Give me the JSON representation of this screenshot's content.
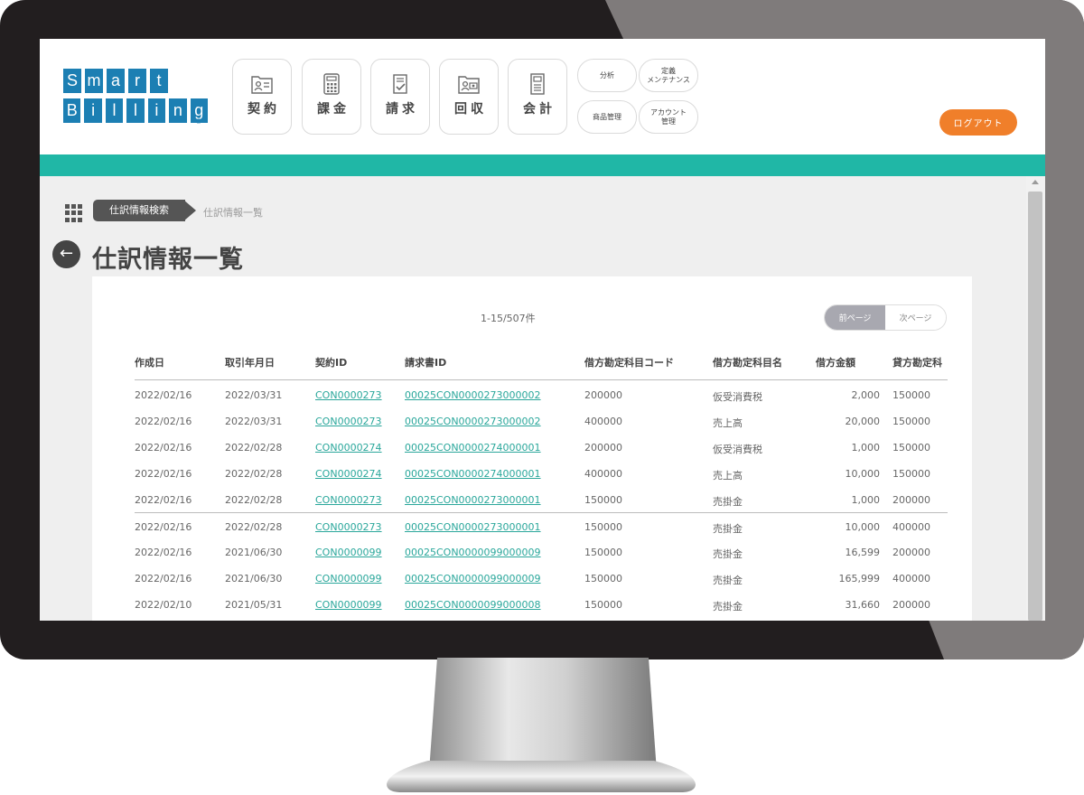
{
  "logo": {
    "line1": [
      "S",
      "m",
      "a",
      "r",
      "t"
    ],
    "line2": [
      "B",
      "i",
      "l",
      "l",
      "i",
      "n",
      "g"
    ],
    "reg": "®"
  },
  "nav": {
    "main": [
      {
        "label": "契約",
        "icon": "contract-icon"
      },
      {
        "label": "課金",
        "icon": "calculator-icon"
      },
      {
        "label": "請求",
        "icon": "invoice-icon"
      },
      {
        "label": "回収",
        "icon": "collection-icon"
      },
      {
        "label": "会計",
        "icon": "accounting-icon"
      }
    ],
    "sub": [
      {
        "label": "分析"
      },
      {
        "label": "定義\nメンテナンス"
      },
      {
        "label": "商品管理"
      },
      {
        "label": "アカウント\n管理"
      }
    ],
    "logout": "ログアウト"
  },
  "breadcrumb": {
    "parent": "仕訳情報検索",
    "current": "仕訳情報一覧"
  },
  "page": {
    "title": "仕訳情報一覧",
    "back_icon": "←"
  },
  "pagination": {
    "count": "1-15/507件",
    "prev": "前ページ",
    "next": "次ページ"
  },
  "table": {
    "headers": [
      "作成日",
      "取引年月日",
      "契約ID",
      "請求書ID",
      "借方勘定科目コード",
      "借方勘定科目名",
      "借方金額",
      "貸方勘定科"
    ],
    "rows": [
      {
        "created": "2022/02/16",
        "trade_date": "2022/03/31",
        "contract_id": "CON0000273",
        "invoice_id": "00025CON0000273000002",
        "debit_code": "200000",
        "debit_name": "仮受消費税",
        "debit_amount": "2,000",
        "credit_code": "150000"
      },
      {
        "created": "2022/02/16",
        "trade_date": "2022/03/31",
        "contract_id": "CON0000273",
        "invoice_id": "00025CON0000273000002",
        "debit_code": "400000",
        "debit_name": "売上高",
        "debit_amount": "20,000",
        "credit_code": "150000"
      },
      {
        "created": "2022/02/16",
        "trade_date": "2022/02/28",
        "contract_id": "CON0000274",
        "invoice_id": "00025CON0000274000001",
        "debit_code": "200000",
        "debit_name": "仮受消費税",
        "debit_amount": "1,000",
        "credit_code": "150000"
      },
      {
        "created": "2022/02/16",
        "trade_date": "2022/02/28",
        "contract_id": "CON0000274",
        "invoice_id": "00025CON0000274000001",
        "debit_code": "400000",
        "debit_name": "売上高",
        "debit_amount": "10,000",
        "credit_code": "150000"
      },
      {
        "created": "2022/02/16",
        "trade_date": "2022/02/28",
        "contract_id": "CON0000273",
        "invoice_id": "00025CON0000273000001",
        "debit_code": "150000",
        "debit_name": "売掛金",
        "debit_amount": "1,000",
        "credit_code": "200000"
      },
      {
        "created": "2022/02/16",
        "trade_date": "2022/02/28",
        "contract_id": "CON0000273",
        "invoice_id": "00025CON0000273000001",
        "debit_code": "150000",
        "debit_name": "売掛金",
        "debit_amount": "10,000",
        "credit_code": "400000"
      },
      {
        "created": "2022/02/16",
        "trade_date": "2021/06/30",
        "contract_id": "CON0000099",
        "invoice_id": "00025CON0000099000009",
        "debit_code": "150000",
        "debit_name": "売掛金",
        "debit_amount": "16,599",
        "credit_code": "200000"
      },
      {
        "created": "2022/02/16",
        "trade_date": "2021/06/30",
        "contract_id": "CON0000099",
        "invoice_id": "00025CON0000099000009",
        "debit_code": "150000",
        "debit_name": "売掛金",
        "debit_amount": "165,999",
        "credit_code": "400000"
      },
      {
        "created": "2022/02/10",
        "trade_date": "2021/05/31",
        "contract_id": "CON0000099",
        "invoice_id": "00025CON0000099000008",
        "debit_code": "150000",
        "debit_name": "売掛金",
        "debit_amount": "31,660",
        "credit_code": "200000"
      }
    ]
  },
  "colors": {
    "brand_blue": "#1c7fb3",
    "teal": "#20b7a6",
    "link": "#2aa79b",
    "logout_orange": "#f07f2a",
    "bezel": "#221e1f"
  }
}
